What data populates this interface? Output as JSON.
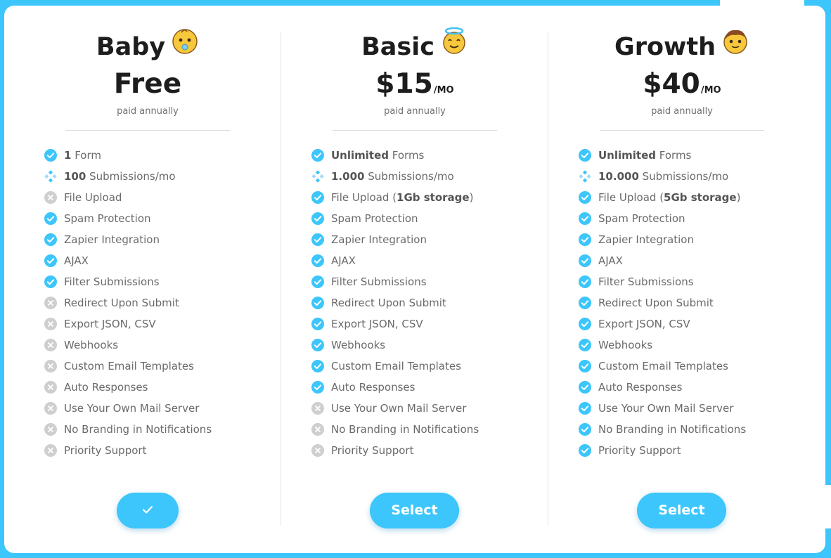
{
  "plans": [
    {
      "name": "Baby",
      "emoji": "baby-face-emoji",
      "price": "Free",
      "price_unit": "",
      "billing": "paid annually",
      "button_label": "",
      "button_icon": "checkmark-icon",
      "selected": true,
      "features": [
        {
          "status": "check",
          "bold": "1",
          "text": " Form"
        },
        {
          "status": "partial",
          "bold": "100",
          "text": " Submissions/mo"
        },
        {
          "status": "cross",
          "text": "File Upload"
        },
        {
          "status": "check",
          "text": "Spam Protection"
        },
        {
          "status": "check",
          "text": "Zapier Integration"
        },
        {
          "status": "check",
          "text": "AJAX"
        },
        {
          "status": "check",
          "text": "Filter Submissions"
        },
        {
          "status": "cross",
          "text": "Redirect Upon Submit"
        },
        {
          "status": "cross",
          "text": "Export JSON, CSV"
        },
        {
          "status": "cross",
          "text": "Webhooks"
        },
        {
          "status": "cross",
          "text": "Custom Email Templates"
        },
        {
          "status": "cross",
          "text": "Auto Responses"
        },
        {
          "status": "cross",
          "text": "Use Your Own Mail Server"
        },
        {
          "status": "cross",
          "text": "No Branding in Notifications"
        },
        {
          "status": "cross",
          "text": "Priority Support"
        }
      ]
    },
    {
      "name": "Basic",
      "emoji": "angel-face-emoji",
      "price": "$15",
      "price_unit": "/MO",
      "billing": "paid annually",
      "button_label": "Select",
      "selected": false,
      "features": [
        {
          "status": "check",
          "bold": "Unlimited",
          "text": " Forms"
        },
        {
          "status": "partial",
          "bold": "1.000",
          "text": " Submissions/mo"
        },
        {
          "status": "check",
          "text": "File Upload (",
          "bold2": "1Gb storage",
          "after": ")"
        },
        {
          "status": "check",
          "text": "Spam Protection"
        },
        {
          "status": "check",
          "text": "Zapier Integration"
        },
        {
          "status": "check",
          "text": "AJAX"
        },
        {
          "status": "check",
          "text": "Filter Submissions"
        },
        {
          "status": "check",
          "text": "Redirect Upon Submit"
        },
        {
          "status": "check",
          "text": "Export JSON, CSV"
        },
        {
          "status": "check",
          "text": "Webhooks"
        },
        {
          "status": "check",
          "text": "Custom Email Templates"
        },
        {
          "status": "check",
          "text": "Auto Responses"
        },
        {
          "status": "cross",
          "text": "Use Your Own Mail Server"
        },
        {
          "status": "cross",
          "text": "No Branding in Notifications"
        },
        {
          "status": "cross",
          "text": "Priority Support"
        }
      ]
    },
    {
      "name": "Growth",
      "emoji": "boy-face-emoji",
      "price": "$40",
      "price_unit": "/MO",
      "billing": "paid annually",
      "button_label": "Select",
      "selected": false,
      "features": [
        {
          "status": "check",
          "bold": "Unlimited",
          "text": " Forms"
        },
        {
          "status": "partial",
          "bold": "10.000",
          "text": " Submissions/mo"
        },
        {
          "status": "check",
          "text": "File Upload (",
          "bold2": "5Gb storage",
          "after": ")"
        },
        {
          "status": "check",
          "text": "Spam Protection"
        },
        {
          "status": "check",
          "text": "Zapier Integration"
        },
        {
          "status": "check",
          "text": "AJAX"
        },
        {
          "status": "check",
          "text": "Filter Submissions"
        },
        {
          "status": "check",
          "text": "Redirect Upon Submit"
        },
        {
          "status": "check",
          "text": "Export JSON, CSV"
        },
        {
          "status": "check",
          "text": "Webhooks"
        },
        {
          "status": "check",
          "text": "Custom Email Templates"
        },
        {
          "status": "check",
          "text": "Auto Responses"
        },
        {
          "status": "check",
          "text": "Use Your Own Mail Server"
        },
        {
          "status": "check",
          "text": "No Branding in Notifications"
        },
        {
          "status": "check",
          "text": "Priority Support"
        }
      ]
    }
  ],
  "colors": {
    "accent": "#3cc6fb",
    "cross": "#cfcfcf",
    "text": "#6a6a6a",
    "heading": "#1d1d1d"
  }
}
